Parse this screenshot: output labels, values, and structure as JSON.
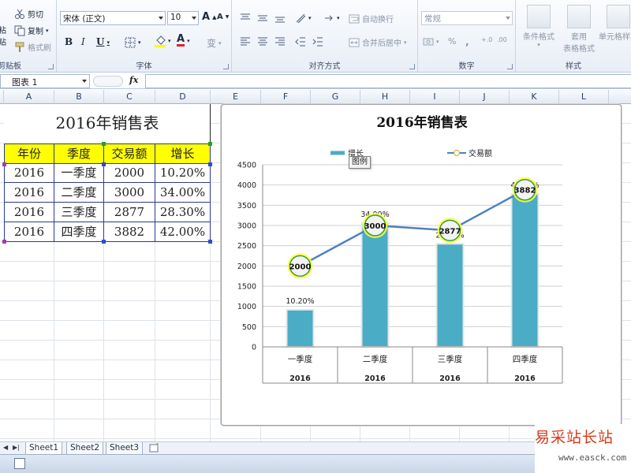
{
  "ribbon": {
    "clipboard": {
      "label": "剪贴板",
      "cut": "剪切",
      "copy": "复制",
      "format_painter": "格式刷",
      "paste": "粘贴"
    },
    "font": {
      "label": "字体",
      "font_name": "宋体 (正文)",
      "font_size": "10",
      "bold": "B",
      "italic": "I",
      "underline": "U",
      "grow": "A",
      "shrink": "A",
      "font_color": "A",
      "phonetic": "变"
    },
    "alignment": {
      "label": "对齐方式",
      "wrap_text": "自动换行",
      "merge_center": "合并后居中"
    },
    "number": {
      "label": "数字",
      "format": "常规",
      "percent": "%",
      "comma": ",",
      "inc_decimal": "+.0",
      "dec_decimal": ".00"
    },
    "styles": {
      "label": "样式",
      "conditional": "条件格式",
      "table_format_1": "套用",
      "table_format_2": "表格格式",
      "cell_styles": "单元格样式"
    }
  },
  "formula_bar": {
    "name_box": "图表 1",
    "fx": "fx",
    "formula": ""
  },
  "columns": [
    "A",
    "B",
    "C",
    "D",
    "E",
    "F",
    "G",
    "H",
    "I",
    "J",
    "K",
    "L"
  ],
  "table": {
    "title": "2016年销售表",
    "headers": [
      "年份",
      "季度",
      "交易额",
      "增长"
    ],
    "rows": [
      [
        "2016",
        "一季度",
        "2000",
        "10.20%"
      ],
      [
        "2016",
        "二季度",
        "3000",
        "34.00%"
      ],
      [
        "2016",
        "三季度",
        "2877",
        "28.30%"
      ],
      [
        "2016",
        "四季度",
        "3882",
        "42.00%"
      ]
    ]
  },
  "chart_data": {
    "type": "bar",
    "title": "2016年销售表",
    "categories": [
      "一季度",
      "二季度",
      "三季度",
      "四季度"
    ],
    "category_group": [
      "2016",
      "2016",
      "2016",
      "2016"
    ],
    "series": [
      {
        "name": "增长",
        "type": "bar",
        "values": [
          0.102,
          0.34,
          0.283,
          0.42
        ],
        "labels": [
          "10.20%",
          "34.00%",
          "28.30%",
          "42.00%"
        ],
        "color": "#4bacc6"
      },
      {
        "name": "交易额",
        "type": "line",
        "values": [
          2000,
          3000,
          2877,
          3882
        ],
        "labels": [
          "2000",
          "3000",
          "2877",
          "3882"
        ],
        "color": "#4f81bd"
      }
    ],
    "y_ticks": [
      "0",
      "500",
      "1000",
      "1500",
      "2000",
      "2500",
      "3000",
      "3500",
      "4000",
      "4500"
    ],
    "ylim": [
      0,
      4500
    ],
    "bar_axis_max": 0.5,
    "grid": true,
    "legend_position": "top"
  },
  "tooltip": "图例",
  "sheets": [
    "Sheet1",
    "Sheet2",
    "Sheet3"
  ],
  "watermark": {
    "name": "易采站长站",
    "url": "www.easck.com"
  },
  "colors": {
    "accent": "#4bacc6",
    "line": "#4f81bd",
    "header_fill": "#ffff00",
    "border": "#2b3a90"
  }
}
